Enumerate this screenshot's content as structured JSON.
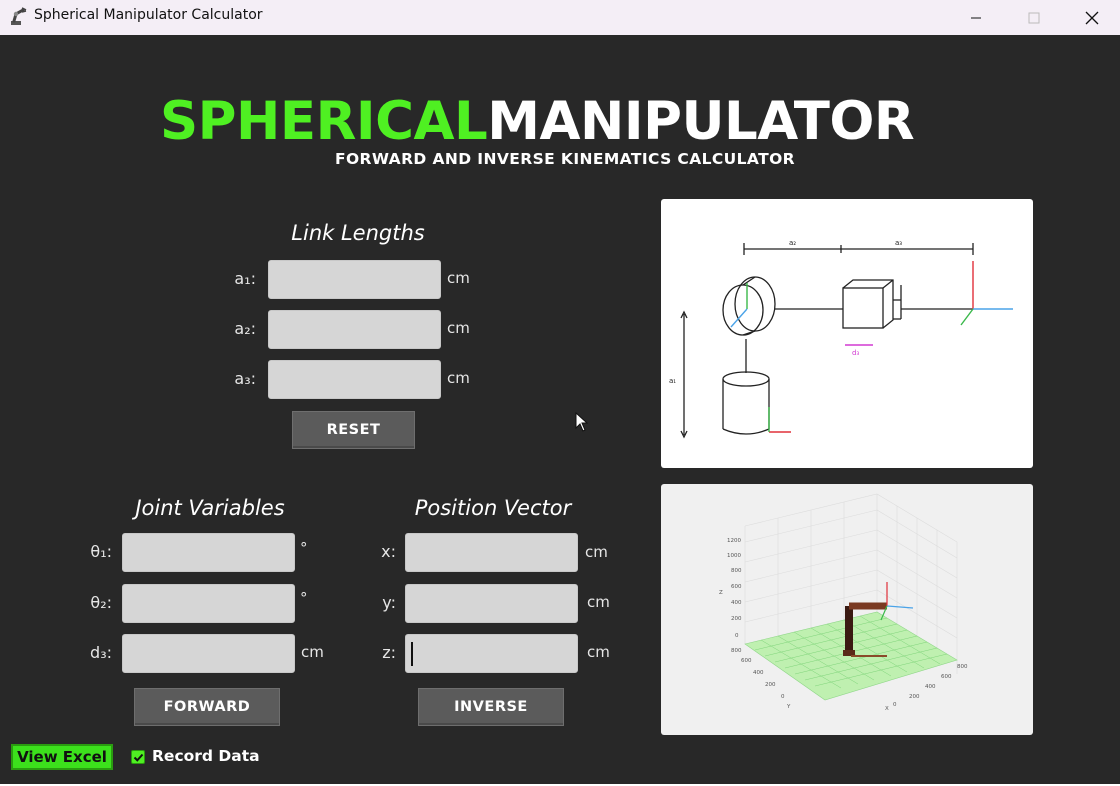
{
  "window": {
    "title": "Spherical Manipulator Calculator",
    "controls": [
      "minimize",
      "maximize",
      "close"
    ]
  },
  "header": {
    "title_part1": "SPHERICAL",
    "title_part2": "MANIPULATOR",
    "subtitle": "FORWARD AND INVERSE KINEMATICS CALCULATOR"
  },
  "link_lengths": {
    "heading": "Link Lengths",
    "fields": [
      {
        "label": "a₁:",
        "value": "",
        "unit": "cm"
      },
      {
        "label": "a₂:",
        "value": "",
        "unit": "cm"
      },
      {
        "label": "a₃:",
        "value": "",
        "unit": "cm"
      }
    ],
    "reset_label": "RESET"
  },
  "joint_variables": {
    "heading": "Joint Variables",
    "fields": [
      {
        "label": "θ₁:",
        "value": "",
        "unit": "°"
      },
      {
        "label": "θ₂:",
        "value": "",
        "unit": "°"
      },
      {
        "label": "d₃:",
        "value": "",
        "unit": "cm"
      }
    ],
    "button_label": "FORWARD"
  },
  "position_vector": {
    "heading": "Position Vector",
    "fields": [
      {
        "label": "x:",
        "value": "",
        "unit": "cm"
      },
      {
        "label": "y:",
        "value": "",
        "unit": "cm"
      },
      {
        "label": "z:",
        "value": "",
        "unit": "cm"
      }
    ],
    "button_label": "INVERSE"
  },
  "footer": {
    "view_excel_label": "View Excel",
    "record_data_label": "Record Data",
    "record_data_checked": true
  },
  "diagram": {
    "dim_labels": [
      "a₁",
      "a₂",
      "a₃",
      "d₃"
    ]
  },
  "plot3d": {
    "z_ticks": [
      "1200",
      "1000",
      "800",
      "600",
      "400",
      "200",
      "0"
    ],
    "axis_labels": [
      "X",
      "Y",
      "Z"
    ],
    "base_ticks": [
      "800",
      "600",
      "400",
      "200",
      "0",
      "-200",
      "-400",
      "-600",
      "-800"
    ]
  },
  "colors": {
    "background": "#282828",
    "accent_green": "#4ff022",
    "field_bg": "#d6d6d6",
    "button_bg": "#5b5b5b"
  }
}
